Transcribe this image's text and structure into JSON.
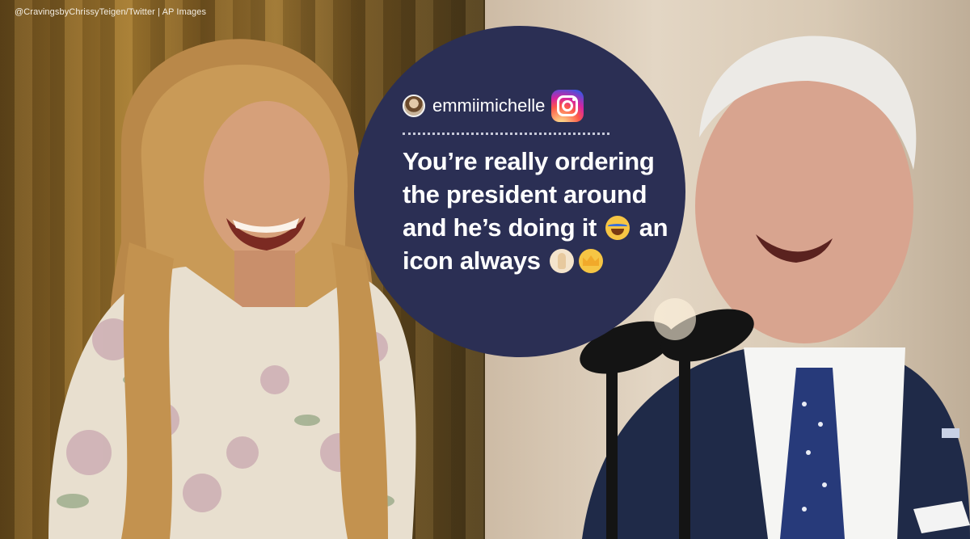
{
  "credit": "@CravingsbyChrissyTeigen/Twitter | AP Images",
  "post": {
    "username": "emmiimichelle",
    "platform_icon": "instagram-icon",
    "quote_lines": [
      "You’re really ordering",
      "the president around",
      "and he’s doing it",
      "an",
      "icon always"
    ],
    "emojis": [
      "face-with-tears-of-joy-icon",
      "folded-hands-icon",
      "crown-icon"
    ]
  },
  "colors": {
    "bubble": "#2b2f54",
    "text": "#ffffff"
  }
}
